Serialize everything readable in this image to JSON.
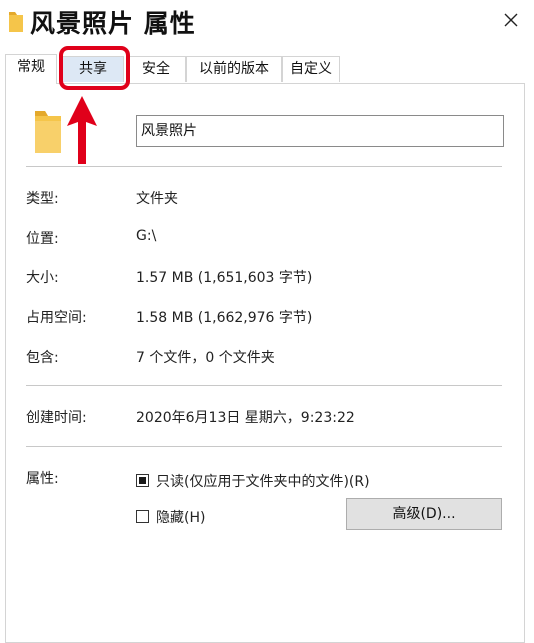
{
  "window": {
    "title": "风景照片 属性"
  },
  "tabs": [
    {
      "label": "常规",
      "active": true
    },
    {
      "label": "共享",
      "active": false,
      "highlighted": true
    },
    {
      "label": "安全",
      "active": false
    },
    {
      "label": "以前的版本",
      "active": false
    },
    {
      "label": "自定义",
      "active": false
    }
  ],
  "general": {
    "folder_name": "风景照片",
    "rows": [
      {
        "label": "类型:",
        "value": "文件夹"
      },
      {
        "label": "位置:",
        "value": "G:\\"
      },
      {
        "label": "大小:",
        "value": "1.57 MB (1,651,603 字节)"
      },
      {
        "label": "占用空间:",
        "value": "1.58 MB (1,662,976 字节)"
      },
      {
        "label": "包含:",
        "value": "7 个文件，0 个文件夹"
      }
    ],
    "created": {
      "label": "创建时间:",
      "value": "2020年6月13日 星期六，9:23:22"
    },
    "attributes": {
      "label": "属性:",
      "readonly": {
        "label": "只读(仅应用于文件夹中的文件)(R)",
        "state": "indeterminate"
      },
      "hidden": {
        "label": "隐藏(H)",
        "state": "unchecked"
      },
      "advanced_button": "高级(D)..."
    }
  },
  "annotation": {
    "highlight_color": "#e0001a",
    "icon": "red-arrow-up-icon"
  },
  "colors": {
    "folder": "#f5c54a",
    "tab_highlight_bg": "#dde8f5"
  }
}
